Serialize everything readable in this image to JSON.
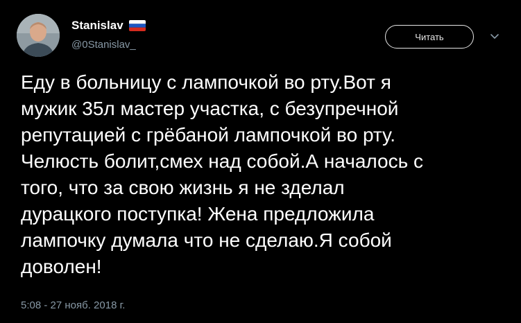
{
  "author": {
    "name": "Stanislav",
    "handle": "@0Stanislav_",
    "flag_icon": "russia-flag-icon"
  },
  "follow_button": {
    "label": "Читать"
  },
  "menu": {
    "icon": "chevron-down-icon"
  },
  "tweet": {
    "text": "Еду в больницу с лампочкой во рту.Вот я\nмужик 35л мастер участка, с безупречной\nрепутацией с грёбаной лампочкой во рту.\nЧелюсть болит,смех над собой.А началось с\nтого, что за свою жизнь я не зделал\nдурацкого поступка! Жена предложила\nлампочку думала что не сделаю.Я собой\nдоволен!",
    "timestamp": "5:08 - 27 нояб. 2018 г."
  },
  "colors": {
    "background": "#000000",
    "text": "#ffffff",
    "muted": "#8899a6"
  }
}
